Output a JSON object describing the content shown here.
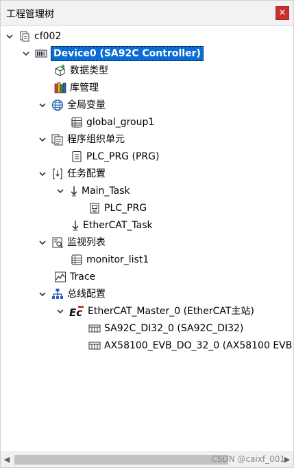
{
  "window": {
    "title": "工程管理树",
    "close_label": "×"
  },
  "tree": {
    "root": "cf002",
    "device": "Device0 (SA92C Controller)",
    "data_types": "数据类型",
    "library_manager": "库管理",
    "global_vars": "全局变量",
    "global_group": "global_group1",
    "program_units": "程序组织单元",
    "plc_prg": "PLC_PRG (PRG)",
    "task_config": "任务配置",
    "main_task": "Main_Task",
    "main_task_plc_prg": "PLC_PRG",
    "ethercat_task": "EtherCAT_Task",
    "watch_list": "监视列表",
    "monitor_list": "monitor_list1",
    "trace": "Trace",
    "bus_config": "总线配置",
    "ethercat_master": "EtherCAT_Master_0 (EtherCAT主站)",
    "ec_icon_text": "Ec",
    "slave_1": "SA92C_DI32_0 (SA92C_DI32)",
    "slave_2": "AX58100_EVB_DO_32_0 (AX58100 EVB"
  },
  "scrollbar": {
    "left_arrow": "◀",
    "right_arrow": "▶"
  },
  "watermark": "CSDN @caixf_001",
  "colors": {
    "selection": "#0a6cd6",
    "close_button": "#c9302c"
  }
}
